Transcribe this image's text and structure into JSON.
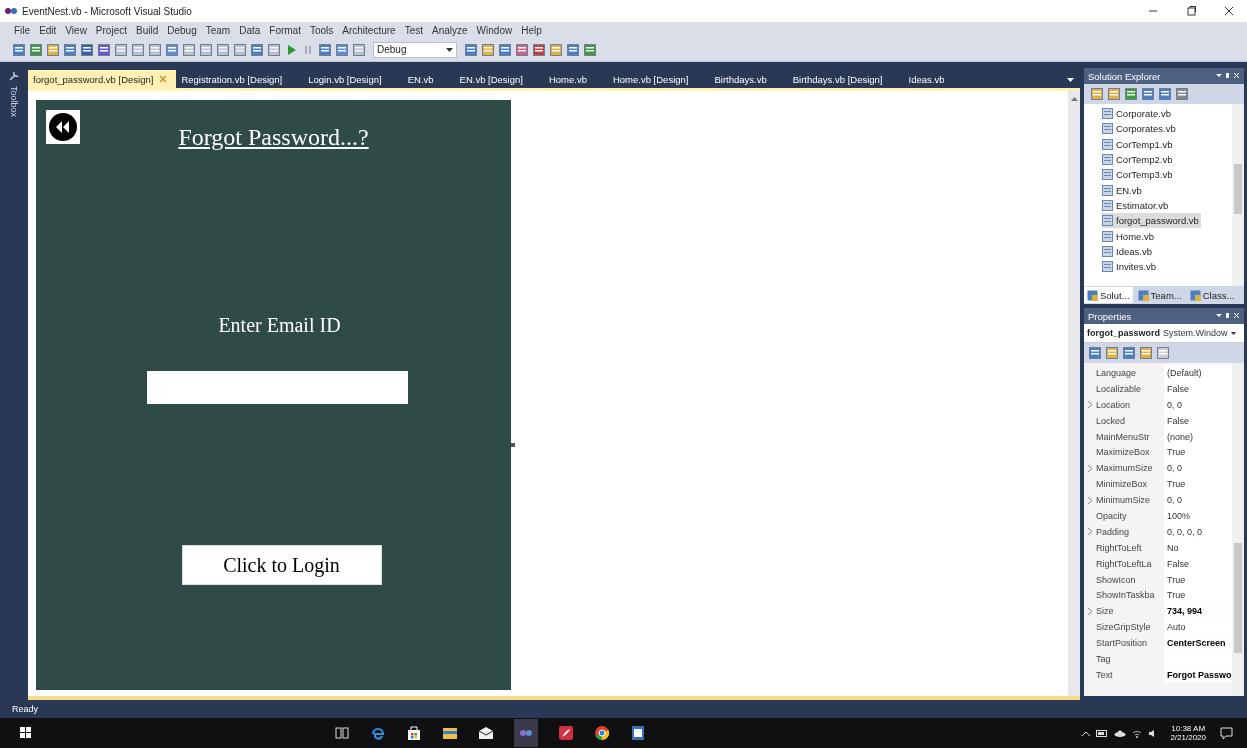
{
  "window": {
    "title": "EventNest.vb - Microsoft Visual Studio"
  },
  "menu": [
    "File",
    "Edit",
    "View",
    "Project",
    "Build",
    "Debug",
    "Team",
    "Data",
    "Format",
    "Tools",
    "Architecture",
    "Test",
    "Analyze",
    "Window",
    "Help"
  ],
  "toolbar": {
    "configuration": "Debug"
  },
  "toolbox": {
    "label": "Toolbox"
  },
  "tabs": [
    {
      "label": "forgot_password.vb [Design]",
      "selected": true
    },
    {
      "label": "Registration.vb [Design]",
      "selected": false
    },
    {
      "label": "Login.vb [Design]",
      "selected": false
    },
    {
      "label": "EN.vb",
      "selected": false
    },
    {
      "label": "EN.vb [Design]",
      "selected": false
    },
    {
      "label": "Home.vb",
      "selected": false
    },
    {
      "label": "Home.vb [Design]",
      "selected": false
    },
    {
      "label": "Birthdays.vb",
      "selected": false
    },
    {
      "label": "Birthdays.vb [Design]",
      "selected": false
    },
    {
      "label": "Ideas.vb",
      "selected": false
    }
  ],
  "form": {
    "title": "Forgot Password...?",
    "label": "Enter Email ID",
    "button": "Click to Login"
  },
  "solution_explorer": {
    "title": "Solution Explorer",
    "items": [
      {
        "label": "Corporate.vb",
        "selected": false
      },
      {
        "label": "Corporates.vb",
        "selected": false
      },
      {
        "label": "CorTemp1.vb",
        "selected": false
      },
      {
        "label": "CorTemp2.vb",
        "selected": false
      },
      {
        "label": "CorTemp3.vb",
        "selected": false
      },
      {
        "label": "EN.vb",
        "selected": false
      },
      {
        "label": "Estimator.vb",
        "selected": false
      },
      {
        "label": "forgot_password.vb",
        "selected": true
      },
      {
        "label": "Home.vb",
        "selected": false
      },
      {
        "label": "Ideas.vb",
        "selected": false
      },
      {
        "label": "Invites.vb",
        "selected": false
      }
    ],
    "tabs": [
      {
        "label": "Solut...",
        "selected": true
      },
      {
        "label": "Team...",
        "selected": false
      },
      {
        "label": "Class...",
        "selected": false
      }
    ]
  },
  "properties": {
    "title": "Properties",
    "object_name": "forgot_password",
    "object_type": "System.Window",
    "rows": [
      {
        "name": "Language",
        "value": "(Default)",
        "expandable": false,
        "bold": false
      },
      {
        "name": "Localizable",
        "value": "False",
        "expandable": false,
        "bold": false
      },
      {
        "name": "Location",
        "value": "0, 0",
        "expandable": true,
        "bold": false
      },
      {
        "name": "Locked",
        "value": "False",
        "expandable": false,
        "bold": false
      },
      {
        "name": "MainMenuStr",
        "value": "(none)",
        "expandable": false,
        "bold": false
      },
      {
        "name": "MaximizeBox",
        "value": "True",
        "expandable": false,
        "bold": false
      },
      {
        "name": "MaximumSize",
        "value": "0, 0",
        "expandable": true,
        "bold": false
      },
      {
        "name": "MinimizeBox",
        "value": "True",
        "expandable": false,
        "bold": false
      },
      {
        "name": "MinimumSize",
        "value": "0, 0",
        "expandable": true,
        "bold": false
      },
      {
        "name": "Opacity",
        "value": "100%",
        "expandable": false,
        "bold": false
      },
      {
        "name": "Padding",
        "value": "0, 0, 0, 0",
        "expandable": true,
        "bold": false
      },
      {
        "name": "RightToLeft",
        "value": "No",
        "expandable": false,
        "bold": false
      },
      {
        "name": "RightToLeftLa",
        "value": "False",
        "expandable": false,
        "bold": false
      },
      {
        "name": "ShowIcon",
        "value": "True",
        "expandable": false,
        "bold": false
      },
      {
        "name": "ShowInTaskba",
        "value": "True",
        "expandable": false,
        "bold": false
      },
      {
        "name": "Size",
        "value": "734, 994",
        "expandable": true,
        "bold": true
      },
      {
        "name": "SizeGripStyle",
        "value": "Auto",
        "expandable": false,
        "bold": false
      },
      {
        "name": "StartPosition",
        "value": "CenterScreen",
        "expandable": false,
        "bold": true
      },
      {
        "name": "Tag",
        "expandable": false
      },
      {
        "name": "Text",
        "value": "Forgot Passwo",
        "expandable": false,
        "bold": true
      }
    ]
  },
  "status_bar": {
    "text": "Ready"
  },
  "taskbar": {
    "time": "10:38 AM",
    "date": "2/21/2020"
  }
}
